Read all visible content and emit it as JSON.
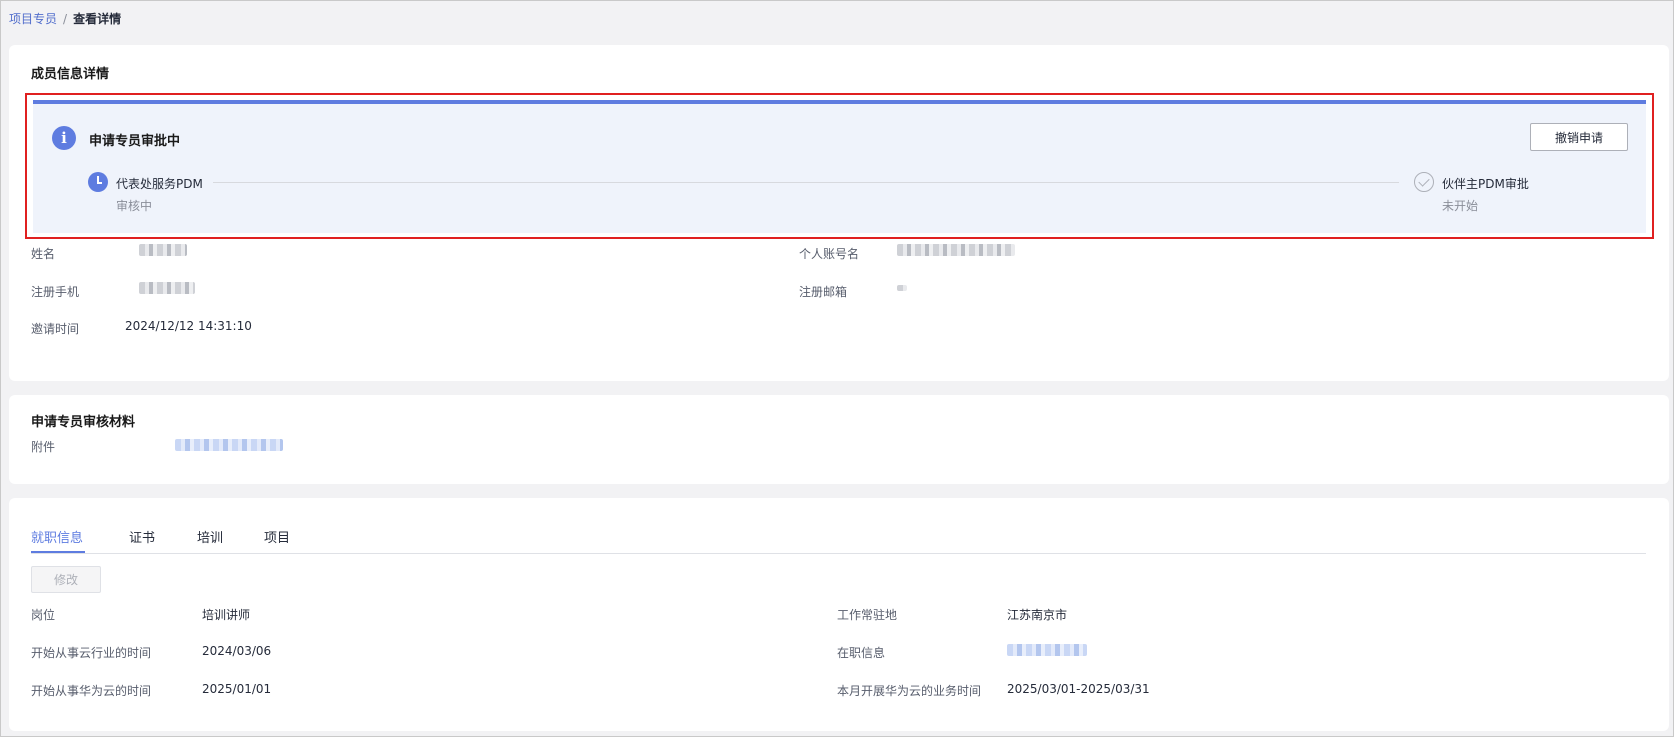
{
  "breadcrumb": {
    "parent": "项目专员",
    "separator": "/",
    "current": "查看详情"
  },
  "member_card": {
    "title": "成员信息详情",
    "approval": {
      "title": "申请专员审批中",
      "revoke_label": "撤销申请",
      "steps": [
        {
          "label": "代表处服务PDM",
          "status": "审核中",
          "icon": "clock-icon"
        },
        {
          "label": "伙伴主PDM审批",
          "status": "未开始",
          "icon": "check-circle-icon"
        }
      ]
    },
    "fields": {
      "name_label": "姓名",
      "account_label": "个人账号名",
      "phone_label": "注册手机",
      "email_label": "注册邮箱",
      "invite_time_label": "邀请时间",
      "invite_time_value": "2024/12/12 14:31:10"
    }
  },
  "materials_card": {
    "title": "申请专员审核材料",
    "attachment_label": "附件"
  },
  "tabs": [
    {
      "label": "就职信息",
      "active": true
    },
    {
      "label": "证书",
      "active": false
    },
    {
      "label": "培训",
      "active": false
    },
    {
      "label": "项目",
      "active": false
    }
  ],
  "employment": {
    "edit_label": "修改",
    "position_label": "岗位",
    "position_value": "培训讲师",
    "location_label": "工作常驻地",
    "location_value": "江苏南京市",
    "cloud_industry_label": "开始从事云行业的时间",
    "cloud_industry_value": "2024/03/06",
    "employment_info_label": "在职信息",
    "huawei_cloud_label": "开始从事华为云的时间",
    "huawei_cloud_value": "2025/01/01",
    "business_time_label": "本月开展华为云的业务时间",
    "business_time_value": "2025/03/01-2025/03/31"
  },
  "colors": {
    "accent": "#5e7ce0",
    "highlight_border": "#e02020",
    "panel_bg": "#eff3fb"
  }
}
